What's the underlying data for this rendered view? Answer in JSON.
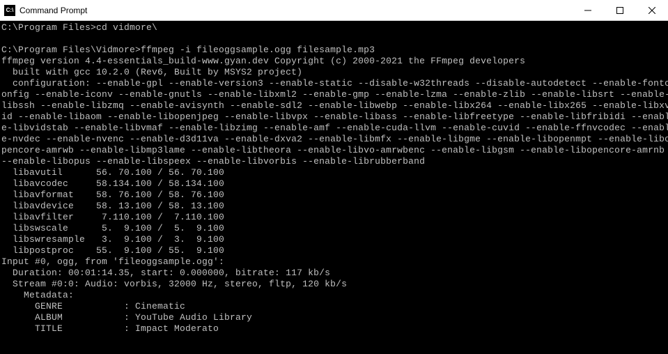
{
  "window": {
    "title": "Command Prompt",
    "icon_label": "cmd-icon"
  },
  "terminal": {
    "lines": [
      "C:\\Program Files>cd vidmore\\",
      "",
      "C:\\Program Files\\Vidmore>ffmpeg -i fileoggsample.ogg filesample.mp3",
      "ffmpeg version 4.4-essentials_build-www.gyan.dev Copyright (c) 2000-2021 the FFmpeg developers",
      "  built with gcc 10.2.0 (Rev6, Built by MSYS2 project)",
      "  configuration: --enable-gpl --enable-version3 --enable-static --disable-w32threads --disable-autodetect --enable-fontc",
      "onfig --enable-iconv --enable-gnutls --enable-libxml2 --enable-gmp --enable-lzma --enable-zlib --enable-libsrt --enable-",
      "libssh --enable-libzmq --enable-avisynth --enable-sdl2 --enable-libwebp --enable-libx264 --enable-libx265 --enable-libxv",
      "id --enable-libaom --enable-libopenjpeg --enable-libvpx --enable-libass --enable-libfreetype --enable-libfribidi --enabl",
      "e-libvidstab --enable-libvmaf --enable-libzimg --enable-amf --enable-cuda-llvm --enable-cuvid --enable-ffnvcodec --enabl",
      "e-nvdec --enable-nvenc --enable-d3d11va --enable-dxva2 --enable-libmfx --enable-libgme --enable-libopenmpt --enable-libo",
      "pencore-amrwb --enable-libmp3lame --enable-libtheora --enable-libvo-amrwbenc --enable-libgsm --enable-libopencore-amrnb ",
      "--enable-libopus --enable-libspeex --enable-libvorbis --enable-librubberband",
      "  libavutil      56. 70.100 / 56. 70.100",
      "  libavcodec     58.134.100 / 58.134.100",
      "  libavformat    58. 76.100 / 58. 76.100",
      "  libavdevice    58. 13.100 / 58. 13.100",
      "  libavfilter     7.110.100 /  7.110.100",
      "  libswscale      5.  9.100 /  5.  9.100",
      "  libswresample   3.  9.100 /  3.  9.100",
      "  libpostproc    55.  9.100 / 55.  9.100",
      "Input #0, ogg, from 'fileoggsample.ogg':",
      "  Duration: 00:01:14.35, start: 0.000000, bitrate: 117 kb/s",
      "  Stream #0:0: Audio: vorbis, 32000 Hz, stereo, fltp, 120 kb/s",
      "    Metadata:",
      "      GENRE           : Cinematic",
      "      ALBUM           : YouTube Audio Library",
      "      TITLE           : Impact Moderato"
    ]
  }
}
